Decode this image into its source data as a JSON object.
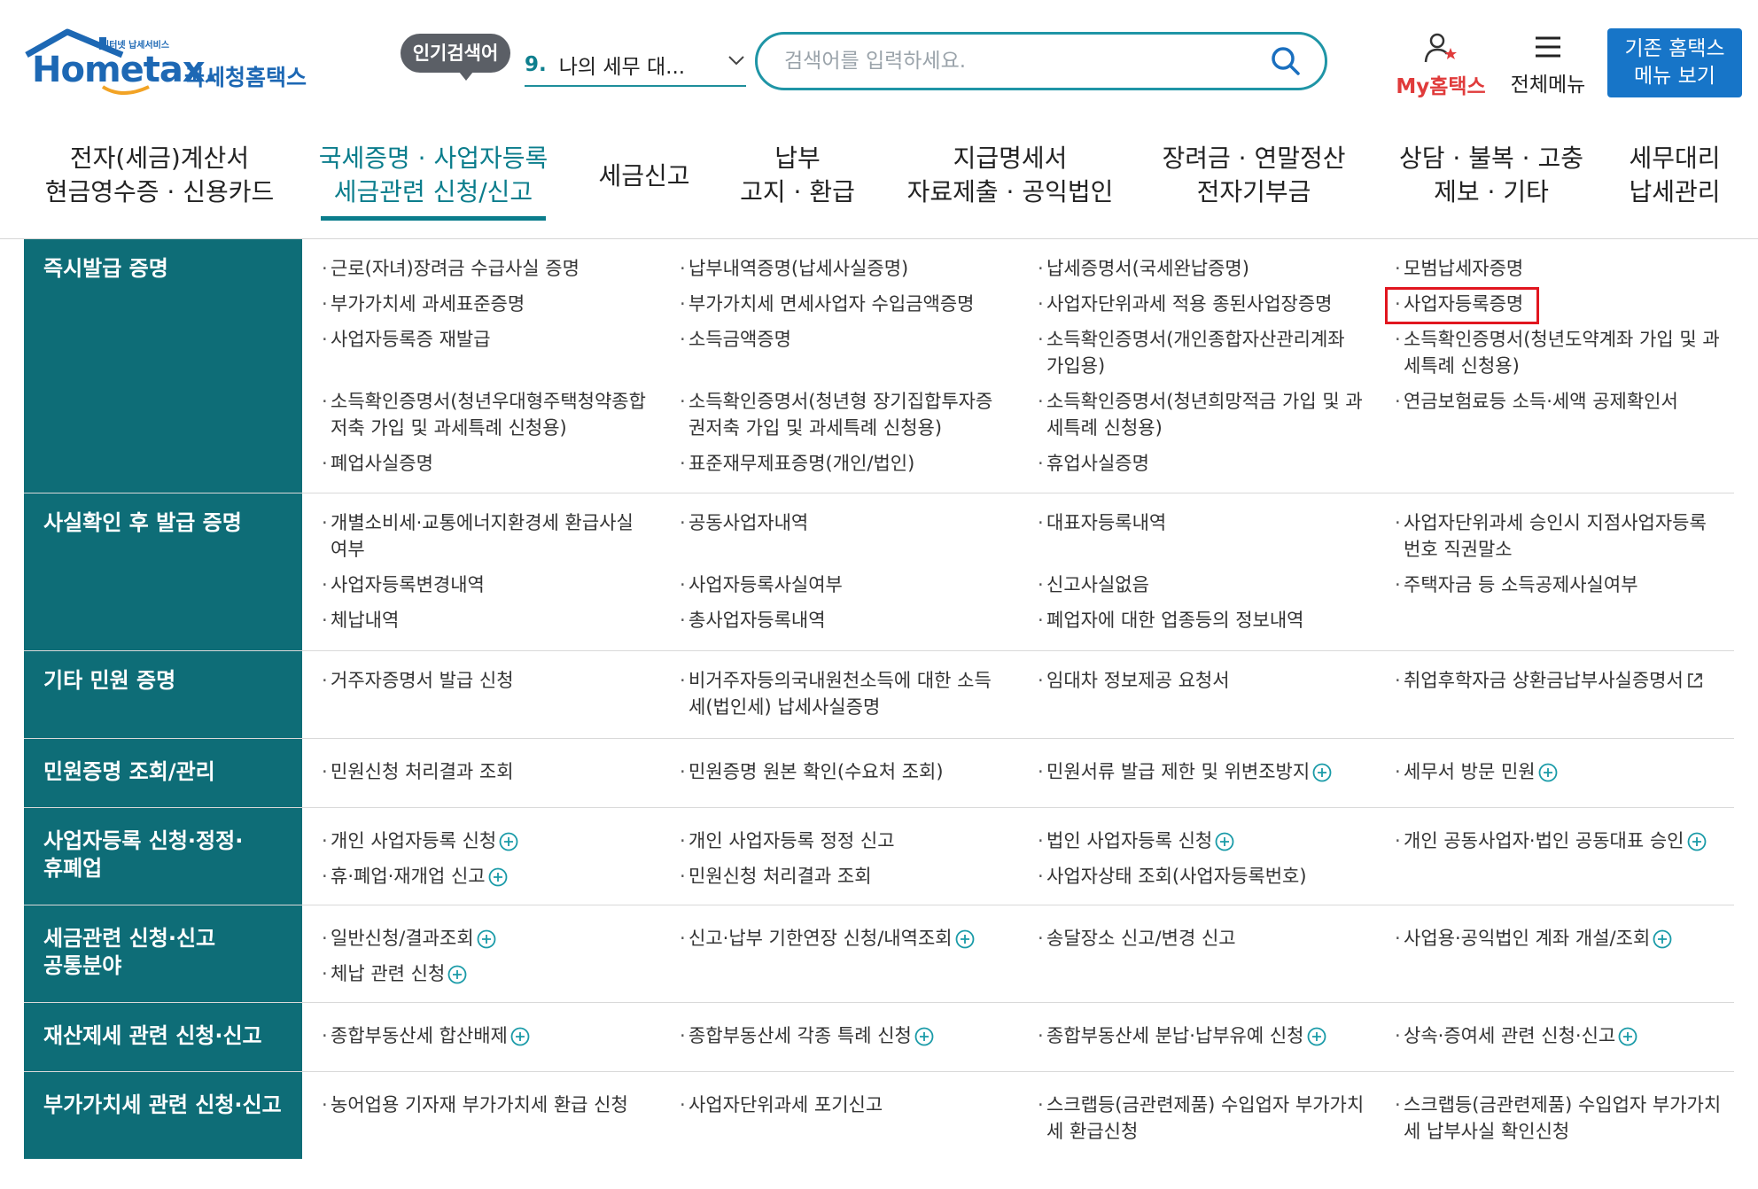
{
  "header": {
    "logo_small_text": "인터넷 납세서비스",
    "logo_main": "Hometax.",
    "logo_sub": "국세청홈택스",
    "popular_badge": "인기검색어",
    "popular_rank": "9.",
    "popular_term": "나의 세무 대...",
    "search_placeholder": "검색어를 입력하세요.",
    "my_hometax": "My홈택스",
    "all_menu": "전체메뉴",
    "old_menu_button": "기존 홈택스\n메뉴 보기"
  },
  "nav": {
    "items": [
      {
        "label": "전자(세금)계산서\n현금영수증 · 신용카드"
      },
      {
        "label": "국세증명 · 사업자등록\n세금관련 신청/신고"
      },
      {
        "label": "세금신고"
      },
      {
        "label": "납부\n고지 · 환급"
      },
      {
        "label": "지급명세서\n자료제출 · 공익법인"
      },
      {
        "label": "장려금 · 연말정산\n전자기부금"
      },
      {
        "label": "상담 · 불복 · 고충\n제보 · 기타"
      },
      {
        "label": "세무대리\n납세관리"
      }
    ]
  },
  "sections": [
    {
      "title": "즉시발급 증명",
      "items": [
        "근로(자녀)장려금 수급사실 증명",
        "납부내역증명(납세사실증명)",
        "납세증명서(국세완납증명)",
        "모범납세자증명",
        "부가가치세 과세표준증명",
        "부가가치세 면세사업자 수입금액증명",
        "사업자단위과세 적용 종된사업장증명",
        "사업자등록증명",
        "사업자등록증 재발급",
        "소득금액증명",
        "소득확인증명서(개인종합자산관리계좌\n가입용)",
        "소득확인증명서(청년도약계좌 가입 및 과\n세특례 신청용)",
        "소득확인증명서(청년우대형주택청약종합\n저축 가입 및 과세특례 신청용)",
        "소득확인증명서(청년형 장기집합투자증\n권저축 가입 및 과세특례 신청용)",
        "소득확인증명서(청년희망적금 가입 및 과\n세특례 신청용)",
        "연금보험료등 소득·세액 공제확인서",
        "폐업사실증명",
        "표준재무제표증명(개인/법인)",
        "휴업사실증명"
      ]
    },
    {
      "title": "사실확인 후 발급 증명",
      "items": [
        "개별소비세·교통에너지환경세 환급사실\n여부",
        "공동사업자내역",
        "대표자등록내역",
        "사업자단위과세 승인시 지점사업자등록\n번호 직권말소",
        "사업자등록변경내역",
        "사업자등록사실여부",
        "신고사실없음",
        "주택자금 등 소득공제사실여부",
        "체납내역",
        "총사업자등록내역",
        "폐업자에 대한 업종등의 정보내역"
      ]
    },
    {
      "title": "기타 민원 증명",
      "items": [
        "거주자증명서 발급 신청",
        "비거주자등의국내원천소득에 대한 소득\n세(법인세) 납세사실증명",
        "임대차 정보제공 요청서",
        "취업후학자금 상환금납부사실증명서"
      ]
    },
    {
      "title": "민원증명 조회/관리",
      "items": [
        "민원신청 처리결과 조회",
        "민원증명 원본 확인(수요처 조회)",
        "민원서류 발급 제한 및 위변조방지",
        "세무서 방문 민원"
      ]
    },
    {
      "title": "사업자등록 신청·정정·\n휴폐업",
      "items": [
        "개인 사업자등록 신청",
        "개인 사업자등록 정정 신고",
        "법인 사업자등록 신청",
        "개인 공동사업자·법인 공동대표 승인",
        "휴·폐업·재개업 신고",
        "민원신청 처리결과 조회",
        "사업자상태 조회(사업자등록번호)"
      ]
    },
    {
      "title": "세금관련 신청·신고\n공통분야",
      "items": [
        "일반신청/결과조회",
        "신고·납부 기한연장 신청/내역조회",
        "송달장소 신고/변경 신고",
        "사업용·공익법인 계좌 개설/조회",
        "체납 관련 신청"
      ]
    },
    {
      "title": "재산제세 관련 신청·신고",
      "items": [
        "종합부동산세 합산배제",
        "종합부동산세 각종 특례 신청",
        "종합부동산세 분납·납부유예 신청",
        "상속·증여세 관련 신청·신고"
      ]
    },
    {
      "title": "부가가치세 관련 신청·신고",
      "items": [
        "농어업용 기자재 부가가치세 환급 신청",
        "사업자단위과세 포기신고",
        "스크랩등(금관련제품) 수입업자 부가가치\n세 환급신청",
        "스크랩등(금관련제품) 수입업자 부가가치\n세 납부사실 확인신청"
      ]
    }
  ]
}
